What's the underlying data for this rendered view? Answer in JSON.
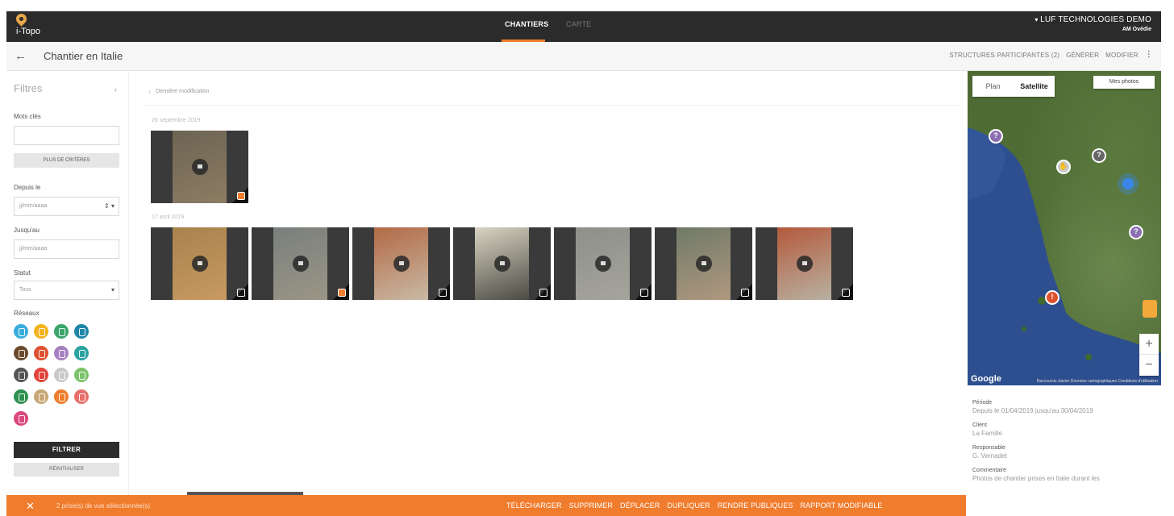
{
  "app": {
    "name": "i-Topo"
  },
  "nav": {
    "tabs": [
      {
        "label": "CHANTIERS"
      },
      {
        "label": "CARTE"
      }
    ]
  },
  "org": {
    "name": "LUF TECHNOLOGIES DEMO",
    "sub": "AM Ovédie"
  },
  "header": {
    "title": "Chantier en Italie",
    "actions": {
      "structures": "STRUCTURES PARTICIPANTES (2)",
      "generer": "GÉNÉRER",
      "modifier": "MODIFIER",
      "more": "⋮"
    }
  },
  "filters": {
    "title": "Filtres",
    "collapse": "‹",
    "keywords_label": "Mots clés",
    "more_criteria": "PLUS DE CRITÈRES",
    "since_label": "Depuis le",
    "since_placeholder": "jj/mm/aaaa",
    "until_label": "Jusqu'au",
    "until_placeholder": "jj/mm/aaaa",
    "status_label": "Statut",
    "status_value": "Tous",
    "network_label": "Réseaux",
    "networks": [
      {
        "icon": "water-drop-icon",
        "color": "#3aaedb"
      },
      {
        "icon": "lightbulb-icon",
        "color": "#f3b41e"
      },
      {
        "icon": "phone-icon",
        "color": "#3aa56a"
      },
      {
        "icon": "cloud-icon",
        "color": "#1f86a8"
      },
      {
        "icon": "sewer-icon",
        "color": "#6b4a2c"
      },
      {
        "icon": "gas-icon",
        "color": "#e0522f"
      },
      {
        "icon": "building-icon",
        "color": "#a780c2"
      },
      {
        "icon": "thermometer-icon",
        "color": "#2ba3a0"
      },
      {
        "icon": "unknown-icon",
        "color": "#555555"
      },
      {
        "icon": "warning-icon",
        "color": "#e2433a"
      },
      {
        "icon": "hand-icon",
        "color": "#c9c9c9"
      },
      {
        "icon": "car-icon",
        "color": "#7dc36a"
      },
      {
        "icon": "tree-icon",
        "color": "#2f8f4f"
      },
      {
        "icon": "pole-icon",
        "color": "#c8a676"
      },
      {
        "icon": "recycle-icon",
        "color": "#ef7d2d"
      },
      {
        "icon": "heat-icon",
        "color": "#e7706b"
      },
      {
        "icon": "pipe-icon",
        "color": "#d9477d"
      }
    ],
    "filter_button": "FILTRER",
    "reset_button": "RÉINITIALISER"
  },
  "gallery": {
    "sort_label": "Dernière modification",
    "groups": [
      {
        "date": "26 septembre 2019",
        "photos": [
          {
            "checked": true,
            "colors": [
              "#6d6453",
              "#8c7d63"
            ]
          }
        ]
      },
      {
        "date": "17 avril 2019",
        "photos": [
          {
            "checked": false,
            "colors": [
              "#a8824c",
              "#c89a62"
            ]
          },
          {
            "checked": true,
            "colors": [
              "#7a7f7c",
              "#9a9686"
            ]
          },
          {
            "checked": false,
            "colors": [
              "#b26a46",
              "#c9b9a4"
            ]
          },
          {
            "checked": false,
            "colors": [
              "#d9d3c3",
              "#4b4b43"
            ]
          },
          {
            "checked": false,
            "colors": [
              "#8f8f8a",
              "#a5a59d"
            ]
          },
          {
            "checked": false,
            "colors": [
              "#6f7a67",
              "#b09880"
            ]
          },
          {
            "checked": false,
            "colors": [
              "#b45a3c",
              "#b8b1a2"
            ]
          }
        ]
      }
    ]
  },
  "map": {
    "type_plan": "Plan",
    "type_satellite": "Satellite",
    "my_photos": "Mes photos",
    "zoom_in": "+",
    "zoom_out": "−",
    "logo": "Google",
    "attribution": "Raccourcis clavier  Données cartographiques  Conditions d'utilisation"
  },
  "details": {
    "period_label": "Période",
    "period_value": "Depuis le 01/04/2019 jusqu'au 30/04/2019",
    "client_label": "Client",
    "client_value": "La Famille",
    "manager_label": "Responsable",
    "manager_value": "G. Vernadet",
    "comment_label": "Commentaire",
    "comment_value": "Photos de chantier prises en Italie durant les"
  },
  "selection_bar": {
    "close": "✕",
    "count_text": "2 prise(s) de vue sélectionnée(s)",
    "actions": [
      "TÉLÉCHARGER",
      "SUPPRIMER",
      "DÉPLACER",
      "DUPLIQUER",
      "RENDRE PUBLIQUES",
      "RAPPORT MODIFIABLE"
    ]
  }
}
